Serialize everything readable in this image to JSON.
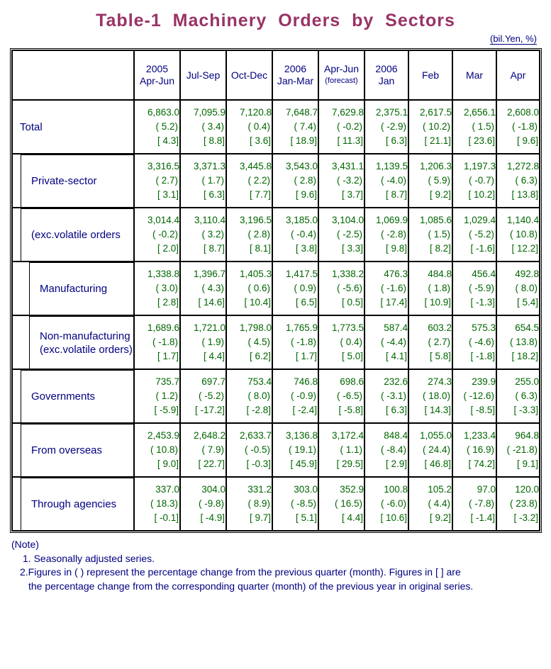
{
  "title": "Table-1  Machinery  Orders  by  Sectors",
  "unit_caption": "(bil.Yen, %)",
  "header": {
    "corner": "",
    "columns": [
      {
        "year": "2005",
        "period": "Apr-Jun",
        "note": ""
      },
      {
        "year": "",
        "period": "Jul-Sep",
        "note": ""
      },
      {
        "year": "",
        "period": "Oct-Dec",
        "note": ""
      },
      {
        "year": "2006",
        "period": "Jan-Mar",
        "note": ""
      },
      {
        "year": "",
        "period": "Apr-Jun",
        "note": "(forecast)"
      },
      {
        "year": "2006",
        "period": "Jan",
        "note": ""
      },
      {
        "year": "",
        "period": "Feb",
        "note": ""
      },
      {
        "year": "",
        "period": "Mar",
        "note": ""
      },
      {
        "year": "",
        "period": "Apr",
        "note": ""
      }
    ]
  },
  "rows": [
    {
      "label": "Total",
      "indent": 0,
      "cells": [
        {
          "value": "6,863.0",
          "qoq": "( 5.2)",
          "yoy": "[ 4.3]"
        },
        {
          "value": "7,095.9",
          "qoq": "( 3.4)",
          "yoy": "[ 8.8]"
        },
        {
          "value": "7,120.8",
          "qoq": "( 0.4)",
          "yoy": "[ 3.6]"
        },
        {
          "value": "7,648.7",
          "qoq": "( 7.4)",
          "yoy": "[ 18.9]"
        },
        {
          "value": "7,629.8",
          "qoq": "( -0.2)",
          "yoy": "[ 11.3]"
        },
        {
          "value": "2,375.1",
          "qoq": "( -2.9)",
          "yoy": "[ 6.3]"
        },
        {
          "value": "2,617.5",
          "qoq": "( 10.2)",
          "yoy": "[ 21.1]"
        },
        {
          "value": "2,656.1",
          "qoq": "( 1.5)",
          "yoy": "[ 23.6]"
        },
        {
          "value": "2,608.0",
          "qoq": "( -1.8)",
          "yoy": "[ 9.6]"
        }
      ]
    },
    {
      "label": "Private-sector",
      "indent": 1,
      "cells": [
        {
          "value": "3,316.5",
          "qoq": "( 2.7)",
          "yoy": "[ 3.1]"
        },
        {
          "value": "3,371.3",
          "qoq": "( 1.7)",
          "yoy": "[ 6.3]"
        },
        {
          "value": "3,445.8",
          "qoq": "( 2.2)",
          "yoy": "[ 7.7]"
        },
        {
          "value": "3,543.0",
          "qoq": "( 2.8)",
          "yoy": "[ 9.6]"
        },
        {
          "value": "3,431.1",
          "qoq": "( -3.2)",
          "yoy": "[ 3.7]"
        },
        {
          "value": "1,139.5",
          "qoq": "( -4.0)",
          "yoy": "[ 8.7]"
        },
        {
          "value": "1,206.3",
          "qoq": "( 5.9)",
          "yoy": "[ 9.2]"
        },
        {
          "value": "1,197.3",
          "qoq": "( -0.7)",
          "yoy": "[ 10.2]"
        },
        {
          "value": "1,272.8",
          "qoq": "( 6.3)",
          "yoy": "[ 13.8]"
        }
      ]
    },
    {
      "label": "(exc.volatile orders",
      "indent": 1,
      "cells": [
        {
          "value": "3,014.4",
          "qoq": "( -0.2)",
          "yoy": "[ 2.0]"
        },
        {
          "value": "3,110.4",
          "qoq": "( 3.2)",
          "yoy": "[ 8.7]"
        },
        {
          "value": "3,196.5",
          "qoq": "( 2.8)",
          "yoy": "[ 8.1]"
        },
        {
          "value": "3,185.0",
          "qoq": "( -0.4)",
          "yoy": "[ 3.8]"
        },
        {
          "value": "3,104.0",
          "qoq": "( -2.5)",
          "yoy": "[ 3.3]"
        },
        {
          "value": "1,069.9",
          "qoq": "( -2.8)",
          "yoy": "[ 9.8]"
        },
        {
          "value": "1,085.6",
          "qoq": "( 1.5)",
          "yoy": "[ 8.2]"
        },
        {
          "value": "1,029.4",
          "qoq": "( -5.2)",
          "yoy": "[ -1.6]"
        },
        {
          "value": "1,140.4",
          "qoq": "( 10.8)",
          "yoy": "[ 12.2]"
        }
      ]
    },
    {
      "label": "Manufacturing",
      "indent": 2,
      "cells": [
        {
          "value": "1,338.8",
          "qoq": "( 3.0)",
          "yoy": "[ 2.8]"
        },
        {
          "value": "1,396.7",
          "qoq": "( 4.3)",
          "yoy": "[ 14.6]"
        },
        {
          "value": "1,405.3",
          "qoq": "( 0.6)",
          "yoy": "[ 10.4]"
        },
        {
          "value": "1,417.5",
          "qoq": "( 0.9)",
          "yoy": "[ 6.5]"
        },
        {
          "value": "1,338.2",
          "qoq": "( -5.6)",
          "yoy": "[ 0.5]"
        },
        {
          "value": "476.3",
          "qoq": "( -1.6)",
          "yoy": "[ 17.4]"
        },
        {
          "value": "484.8",
          "qoq": "( 1.8)",
          "yoy": "[ 10.9]"
        },
        {
          "value": "456.4",
          "qoq": "( -5.9)",
          "yoy": "[ -1.3]"
        },
        {
          "value": "492.8",
          "qoq": "( 8.0)",
          "yoy": "[ 5.4]"
        }
      ]
    },
    {
      "label": "Non-manufacturing\n(exc.volatile orders)",
      "indent": 2,
      "cells": [
        {
          "value": "1,689.6",
          "qoq": "( -1.8)",
          "yoy": "[ 1.7]"
        },
        {
          "value": "1,721.0",
          "qoq": "( 1.9)",
          "yoy": "[ 4.4]"
        },
        {
          "value": "1,798.0",
          "qoq": "( 4.5)",
          "yoy": "[ 6.2]"
        },
        {
          "value": "1,765.9",
          "qoq": "( -1.8)",
          "yoy": "[ 1.7]"
        },
        {
          "value": "1,773.5",
          "qoq": "( 0.4)",
          "yoy": "[ 5.0]"
        },
        {
          "value": "587.4",
          "qoq": "( -4.4)",
          "yoy": "[ 4.1]"
        },
        {
          "value": "603.2",
          "qoq": "( 2.7)",
          "yoy": "[ 5.8]"
        },
        {
          "value": "575.3",
          "qoq": "( -4.6)",
          "yoy": "[ -1.8]"
        },
        {
          "value": "654.5",
          "qoq": "( 13.8)",
          "yoy": "[ 18.2]"
        }
      ]
    },
    {
      "label": "Governments",
      "indent": 1,
      "cells": [
        {
          "value": "735.7",
          "qoq": "( 1.2)",
          "yoy": "[ -5.9]"
        },
        {
          "value": "697.7",
          "qoq": "( -5.2)",
          "yoy": "[ -17.2]"
        },
        {
          "value": "753.4",
          "qoq": "( 8.0)",
          "yoy": "[ -2.8]"
        },
        {
          "value": "746.8",
          "qoq": "( -0.9)",
          "yoy": "[ -2.4]"
        },
        {
          "value": "698.6",
          "qoq": "( -6.5)",
          "yoy": "[ -5.8]"
        },
        {
          "value": "232.6",
          "qoq": "( -3.1)",
          "yoy": "[ 6.3]"
        },
        {
          "value": "274.3",
          "qoq": "( 18.0)",
          "yoy": "[ 14.3]"
        },
        {
          "value": "239.9",
          "qoq": "( -12.6)",
          "yoy": "[ -8.5]"
        },
        {
          "value": "255.0",
          "qoq": "( 6.3)",
          "yoy": "[ -3.3]"
        }
      ]
    },
    {
      "label": "From overseas",
      "indent": 1,
      "cells": [
        {
          "value": "2,453.9",
          "qoq": "( 10.8)",
          "yoy": "[ 9.0]"
        },
        {
          "value": "2,648.2",
          "qoq": "( 7.9)",
          "yoy": "[ 22.7]"
        },
        {
          "value": "2,633.7",
          "qoq": "( -0.5)",
          "yoy": "[ -0.3]"
        },
        {
          "value": "3,136.8",
          "qoq": "( 19.1)",
          "yoy": "[ 45.9]"
        },
        {
          "value": "3,172.4",
          "qoq": "( 1.1)",
          "yoy": "[ 29.5]"
        },
        {
          "value": "848.4",
          "qoq": "( -8.4)",
          "yoy": "[ 2.9]"
        },
        {
          "value": "1,055.0",
          "qoq": "( 24.4)",
          "yoy": "[ 46.8]"
        },
        {
          "value": "1,233.4",
          "qoq": "( 16.9)",
          "yoy": "[ 74.2]"
        },
        {
          "value": "964.8",
          "qoq": "( -21.8)",
          "yoy": "[ 9.1]"
        }
      ]
    },
    {
      "label": "Through agencies",
      "indent": 1,
      "cells": [
        {
          "value": "337.0",
          "qoq": "( 18.3)",
          "yoy": "[ -0.1]"
        },
        {
          "value": "304.0",
          "qoq": "( -9.8)",
          "yoy": "[ -4.9]"
        },
        {
          "value": "331.2",
          "qoq": "( 8.9)",
          "yoy": "[ 9.7]"
        },
        {
          "value": "303.0",
          "qoq": "( -8.5)",
          "yoy": "[ 5.1]"
        },
        {
          "value": "352.9",
          "qoq": "( 16.5)",
          "yoy": "[ 4.4]"
        },
        {
          "value": "100.8",
          "qoq": "( -6.0)",
          "yoy": "[ 10.6]"
        },
        {
          "value": "105.2",
          "qoq": "( 4.4)",
          "yoy": "[ 9.2]"
        },
        {
          "value": "97.0",
          "qoq": "( -7.8)",
          "yoy": "[ -1.4]"
        },
        {
          "value": "120.0",
          "qoq": "( 23.8)",
          "yoy": "[ -3.2]"
        }
      ]
    }
  ],
  "notes": {
    "heading": "(Note)",
    "line1": "1. Seasonally adjusted series.",
    "line2a": "2.Figures in ( ) represent the percentage change from the previous quarter (month). Figures in [ ] are",
    "line2b": "the percentage change from the corresponding quarter (month) of the previous year in original series."
  },
  "colors": {
    "title": "#993366",
    "label": "#000080",
    "value": "#006600",
    "border": "#000000",
    "background": "#ffffff"
  },
  "chart_data": {
    "type": "table",
    "title": "Table-1  Machinery  Orders  by  Sectors",
    "unit": "(bil.Yen, %)",
    "columns": [
      "2005 Apr-Jun",
      "2005 Jul-Sep",
      "2005 Oct-Dec",
      "2006 Jan-Mar",
      "2006 Apr-Jun (forecast)",
      "2006 Jan",
      "2006 Feb",
      "2006 Mar",
      "2006 Apr"
    ],
    "row_labels": [
      "Total",
      "Private-sector",
      "(exc.volatile orders",
      "Manufacturing",
      "Non-manufacturing (exc.volatile orders)",
      "Governments",
      "From overseas",
      "Through agencies"
    ],
    "series": [
      {
        "name": "Total",
        "values": [
          6863.0,
          7095.9,
          7120.8,
          7648.7,
          7629.8,
          2375.1,
          2617.5,
          2656.1,
          2608.0
        ],
        "pct_prev": [
          5.2,
          3.4,
          0.4,
          7.4,
          -0.2,
          -2.9,
          10.2,
          1.5,
          -1.8
        ],
        "pct_yoy": [
          4.3,
          8.8,
          3.6,
          18.9,
          11.3,
          6.3,
          21.1,
          23.6,
          9.6
        ]
      },
      {
        "name": "Private-sector",
        "values": [
          3316.5,
          3371.3,
          3445.8,
          3543.0,
          3431.1,
          1139.5,
          1206.3,
          1197.3,
          1272.8
        ],
        "pct_prev": [
          2.7,
          1.7,
          2.2,
          2.8,
          -3.2,
          -4.0,
          5.9,
          -0.7,
          6.3
        ],
        "pct_yoy": [
          3.1,
          6.3,
          7.7,
          9.6,
          3.7,
          8.7,
          9.2,
          10.2,
          13.8
        ]
      },
      {
        "name": "(exc.volatile orders",
        "values": [
          3014.4,
          3110.4,
          3196.5,
          3185.0,
          3104.0,
          1069.9,
          1085.6,
          1029.4,
          1140.4
        ],
        "pct_prev": [
          -0.2,
          3.2,
          2.8,
          -0.4,
          -2.5,
          -2.8,
          1.5,
          -5.2,
          10.8
        ],
        "pct_yoy": [
          2.0,
          8.7,
          8.1,
          3.8,
          3.3,
          9.8,
          8.2,
          -1.6,
          12.2
        ]
      },
      {
        "name": "Manufacturing",
        "values": [
          1338.8,
          1396.7,
          1405.3,
          1417.5,
          1338.2,
          476.3,
          484.8,
          456.4,
          492.8
        ],
        "pct_prev": [
          3.0,
          4.3,
          0.6,
          0.9,
          -5.6,
          -1.6,
          1.8,
          -5.9,
          8.0
        ],
        "pct_yoy": [
          2.8,
          14.6,
          10.4,
          6.5,
          0.5,
          17.4,
          10.9,
          -1.3,
          5.4
        ]
      },
      {
        "name": "Non-manufacturing (exc.volatile orders)",
        "values": [
          1689.6,
          1721.0,
          1798.0,
          1765.9,
          1773.5,
          587.4,
          603.2,
          575.3,
          654.5
        ],
        "pct_prev": [
          -1.8,
          1.9,
          4.5,
          -1.8,
          0.4,
          -4.4,
          2.7,
          -4.6,
          13.8
        ],
        "pct_yoy": [
          1.7,
          4.4,
          6.2,
          1.7,
          5.0,
          4.1,
          5.8,
          -1.8,
          18.2
        ]
      },
      {
        "name": "Governments",
        "values": [
          735.7,
          697.7,
          753.4,
          746.8,
          698.6,
          232.6,
          274.3,
          239.9,
          255.0
        ],
        "pct_prev": [
          1.2,
          -5.2,
          8.0,
          -0.9,
          -6.5,
          -3.1,
          18.0,
          -12.6,
          6.3
        ],
        "pct_yoy": [
          -5.9,
          -17.2,
          -2.8,
          -2.4,
          -5.8,
          6.3,
          14.3,
          -8.5,
          -3.3
        ]
      },
      {
        "name": "From overseas",
        "values": [
          2453.9,
          2648.2,
          2633.7,
          3136.8,
          3172.4,
          848.4,
          1055.0,
          1233.4,
          964.8
        ],
        "pct_prev": [
          10.8,
          7.9,
          -0.5,
          19.1,
          1.1,
          -8.4,
          24.4,
          16.9,
          -21.8
        ],
        "pct_yoy": [
          9.0,
          22.7,
          -0.3,
          45.9,
          29.5,
          2.9,
          46.8,
          74.2,
          9.1
        ]
      },
      {
        "name": "Through agencies",
        "values": [
          337.0,
          304.0,
          331.2,
          303.0,
          352.9,
          100.8,
          105.2,
          97.0,
          120.0
        ],
        "pct_prev": [
          18.3,
          -9.8,
          8.9,
          -8.5,
          16.5,
          -6.0,
          4.4,
          -7.8,
          23.8
        ],
        "pct_yoy": [
          -0.1,
          -4.9,
          9.7,
          5.1,
          4.4,
          10.6,
          9.2,
          -1.4,
          -3.2
        ]
      }
    ]
  }
}
